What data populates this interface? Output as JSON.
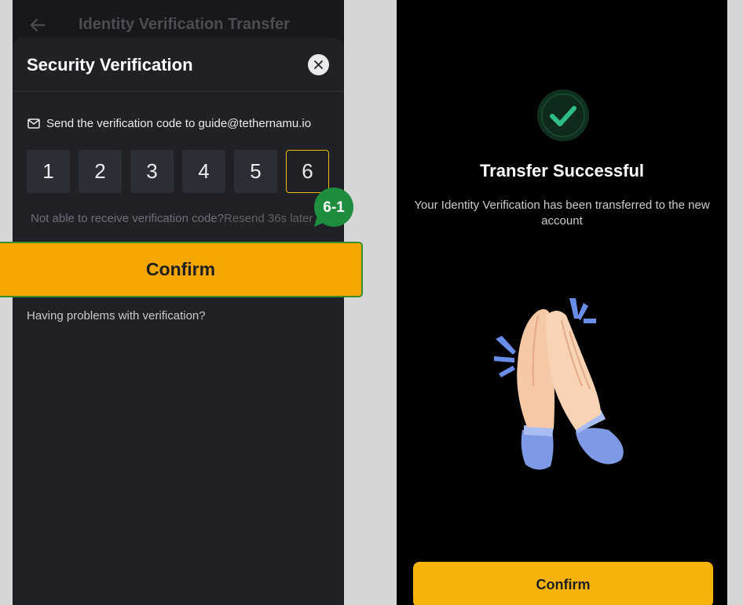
{
  "left_screen": {
    "header_title": "Identity Verification Transfer",
    "sheet": {
      "title": "Security Verification",
      "send_text": "Send the verification code to guide@tethernamu.io",
      "code_digits": [
        "1",
        "2",
        "3",
        "4",
        "5",
        "6"
      ],
      "resend_prompt": "Not able to receive verification code?",
      "resend_link": "Resend 36s later",
      "confirm_label": "Confirm",
      "help_text": "Having problems with verification?"
    },
    "step_badge": "6-1"
  },
  "right_screen": {
    "title": "Transfer Successful",
    "description": "Your Identity Verification has been transferred to the new account",
    "confirm_label": "Confirm"
  },
  "colors": {
    "accent_yellow": "#F5A700",
    "step_green": "#1E8E3E",
    "success_green": "#2EBD85",
    "highlight_border": "#3B8F2B"
  }
}
